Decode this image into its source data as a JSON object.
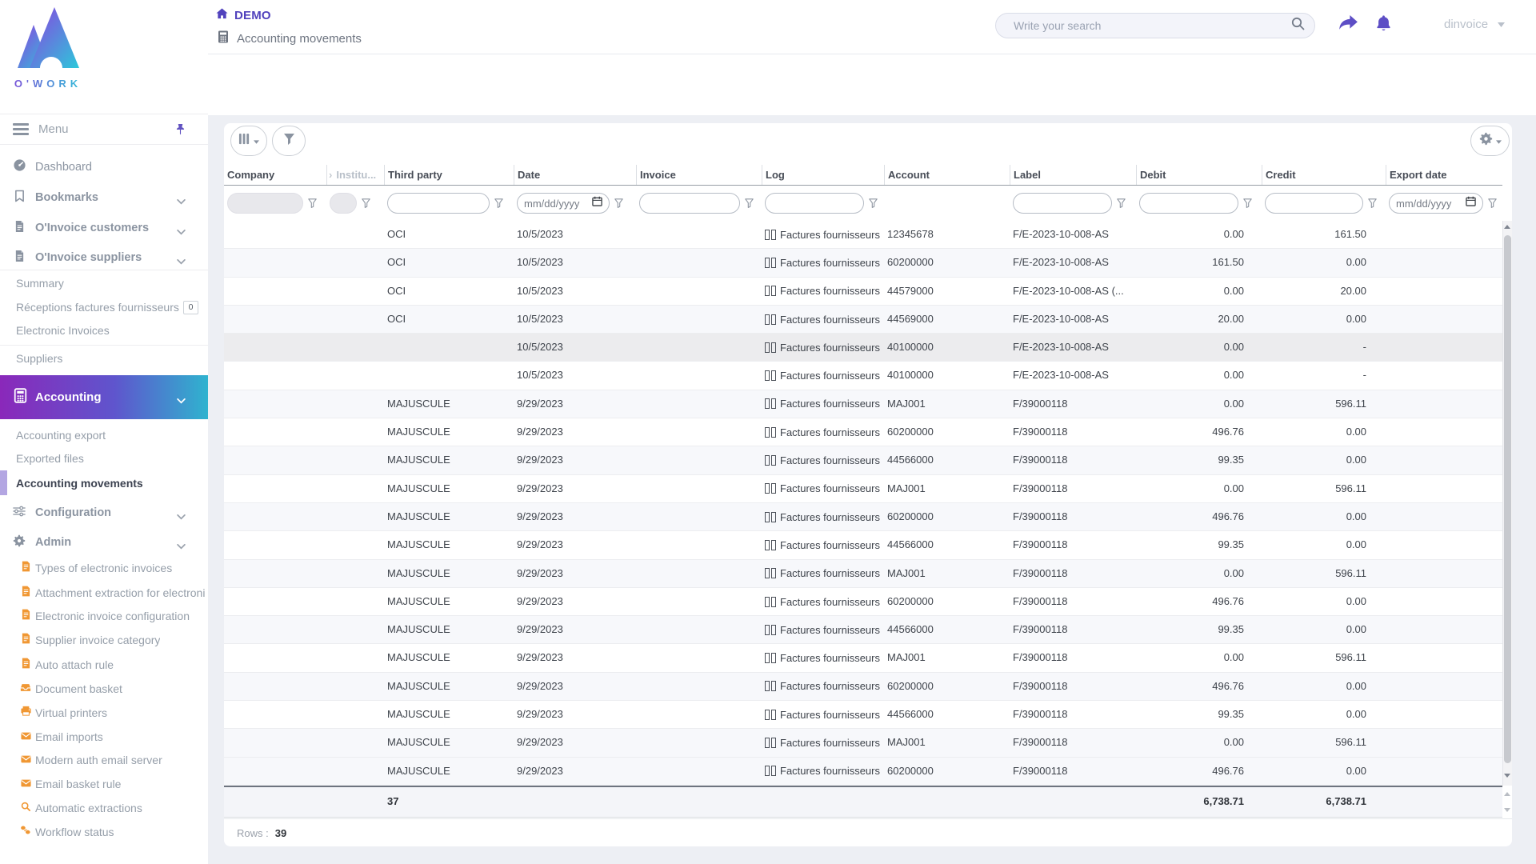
{
  "brand": {
    "logo_text": "O'WORK"
  },
  "topbar": {
    "breadcrumb": {
      "home": "DEMO",
      "page": "Accounting movements"
    },
    "search": {
      "placeholder": "Write your search"
    },
    "user": {
      "name": "dinvoice"
    }
  },
  "sidebar": {
    "menu_label": "Menu",
    "items": [
      {
        "label": "Dashboard",
        "icon": "gauge-icon"
      },
      {
        "label": "Bookmarks",
        "icon": "bookmark-icon"
      },
      {
        "label": "O'Invoice customers",
        "icon": "invoice-file-icon"
      },
      {
        "label": "O'Invoice suppliers",
        "icon": "invoice-file-icon"
      },
      {
        "label": "Summary"
      },
      {
        "label": "Réceptions factures fournisseurs",
        "badge": "0"
      },
      {
        "label": "Electronic Invoices"
      },
      {
        "label": "Suppliers"
      },
      {
        "label": "Accounting",
        "icon": "calculator-icon",
        "active": true
      },
      {
        "label": "Accounting export"
      },
      {
        "label": "Exported files"
      },
      {
        "label": "Accounting movements",
        "active": true
      },
      {
        "label": "Configuration",
        "icon": "sliders-icon"
      },
      {
        "label": "Admin",
        "icon": "gear-icon"
      },
      {
        "label": "Types of electronic invoices",
        "icon": "file-lines-icon"
      },
      {
        "label": "Attachment extraction for electroni",
        "icon": "file-lines-icon"
      },
      {
        "label": "Electronic invoice configuration",
        "icon": "file-lines-icon"
      },
      {
        "label": "Supplier invoice category",
        "icon": "file-lines-icon"
      },
      {
        "label": "Auto attach rule",
        "icon": "file-lines-icon"
      },
      {
        "label": "Document basket",
        "icon": "inbox-icon"
      },
      {
        "label": "Virtual printers",
        "icon": "printer-icon"
      },
      {
        "label": "Email imports",
        "icon": "envelope-icon"
      },
      {
        "label": "Modern auth email server",
        "icon": "envelope-icon"
      },
      {
        "label": "Email basket rule",
        "icon": "envelope-icon"
      },
      {
        "label": "Automatic extractions",
        "icon": "magnifier-icon"
      },
      {
        "label": "Workflow status",
        "icon": "footprints-icon"
      }
    ]
  },
  "table": {
    "columns": [
      "Company",
      "Institu...",
      "Third party",
      "Date",
      "Invoice",
      "Log",
      "Account",
      "Label",
      "Debit",
      "Credit",
      "Export date"
    ],
    "date_filter_placeholder": "mm/dd/yyyy",
    "rows": [
      {
        "company": "",
        "third_party": "OCI",
        "date": "10/5/2023",
        "invoice": "",
        "log": "Factures fournisseurs",
        "account": "12345678",
        "label": "F/E-2023-10-008-AS",
        "debit": "0.00",
        "credit": "161.50",
        "export_date": "",
        "shade": "white"
      },
      {
        "company": "",
        "third_party": "OCI",
        "date": "10/5/2023",
        "invoice": "",
        "log": "Factures fournisseurs",
        "account": "60200000",
        "label": "F/E-2023-10-008-AS",
        "debit": "161.50",
        "credit": "0.00",
        "export_date": "",
        "shade": "stripe"
      },
      {
        "company": "",
        "third_party": "OCI",
        "date": "10/5/2023",
        "invoice": "",
        "log": "Factures fournisseurs",
        "account": "44579000",
        "label": "F/E-2023-10-008-AS (...",
        "debit": "0.00",
        "credit": "20.00",
        "export_date": "",
        "shade": "white"
      },
      {
        "company": "",
        "third_party": "OCI",
        "date": "10/5/2023",
        "invoice": "",
        "log": "Factures fournisseurs",
        "account": "44569000",
        "label": "F/E-2023-10-008-AS",
        "debit": "20.00",
        "credit": "0.00",
        "export_date": "",
        "shade": "stripe"
      },
      {
        "company": "",
        "third_party": "",
        "date": "10/5/2023",
        "invoice": "",
        "log": "Factures fournisseurs",
        "account": "40100000",
        "label": "F/E-2023-10-008-AS",
        "debit": "0.00",
        "credit": "-",
        "export_date": "",
        "shade": "gray"
      },
      {
        "company": "",
        "third_party": "",
        "date": "10/5/2023",
        "invoice": "",
        "log": "Factures fournisseurs",
        "account": "40100000",
        "label": "F/E-2023-10-008-AS",
        "debit": "0.00",
        "credit": "-",
        "export_date": "",
        "shade": "white"
      },
      {
        "company": "",
        "third_party": "MAJUSCULE",
        "date": "9/29/2023",
        "invoice": "",
        "log": "Factures fournisseurs",
        "account": "MAJ001",
        "label": "F/39000118",
        "debit": "0.00",
        "credit": "596.11",
        "export_date": "",
        "shade": "stripe"
      },
      {
        "company": "",
        "third_party": "MAJUSCULE",
        "date": "9/29/2023",
        "invoice": "",
        "log": "Factures fournisseurs",
        "account": "60200000",
        "label": "F/39000118",
        "debit": "496.76",
        "credit": "0.00",
        "export_date": "",
        "shade": "white"
      },
      {
        "company": "",
        "third_party": "MAJUSCULE",
        "date": "9/29/2023",
        "invoice": "",
        "log": "Factures fournisseurs",
        "account": "44566000",
        "label": "F/39000118",
        "debit": "99.35",
        "credit": "0.00",
        "export_date": "",
        "shade": "stripe"
      },
      {
        "company": "",
        "third_party": "MAJUSCULE",
        "date": "9/29/2023",
        "invoice": "",
        "log": "Factures fournisseurs",
        "account": "MAJ001",
        "label": "F/39000118",
        "debit": "0.00",
        "credit": "596.11",
        "export_date": "",
        "shade": "white"
      },
      {
        "company": "",
        "third_party": "MAJUSCULE",
        "date": "9/29/2023",
        "invoice": "",
        "log": "Factures fournisseurs",
        "account": "60200000",
        "label": "F/39000118",
        "debit": "496.76",
        "credit": "0.00",
        "export_date": "",
        "shade": "stripe"
      },
      {
        "company": "",
        "third_party": "MAJUSCULE",
        "date": "9/29/2023",
        "invoice": "",
        "log": "Factures fournisseurs",
        "account": "44566000",
        "label": "F/39000118",
        "debit": "99.35",
        "credit": "0.00",
        "export_date": "",
        "shade": "white"
      },
      {
        "company": "",
        "third_party": "MAJUSCULE",
        "date": "9/29/2023",
        "invoice": "",
        "log": "Factures fournisseurs",
        "account": "MAJ001",
        "label": "F/39000118",
        "debit": "0.00",
        "credit": "596.11",
        "export_date": "",
        "shade": "stripe"
      },
      {
        "company": "",
        "third_party": "MAJUSCULE",
        "date": "9/29/2023",
        "invoice": "",
        "log": "Factures fournisseurs",
        "account": "60200000",
        "label": "F/39000118",
        "debit": "496.76",
        "credit": "0.00",
        "export_date": "",
        "shade": "white"
      },
      {
        "company": "",
        "third_party": "MAJUSCULE",
        "date": "9/29/2023",
        "invoice": "",
        "log": "Factures fournisseurs",
        "account": "44566000",
        "label": "F/39000118",
        "debit": "99.35",
        "credit": "0.00",
        "export_date": "",
        "shade": "stripe"
      },
      {
        "company": "",
        "third_party": "MAJUSCULE",
        "date": "9/29/2023",
        "invoice": "",
        "log": "Factures fournisseurs",
        "account": "MAJ001",
        "label": "F/39000118",
        "debit": "0.00",
        "credit": "596.11",
        "export_date": "",
        "shade": "white"
      },
      {
        "company": "",
        "third_party": "MAJUSCULE",
        "date": "9/29/2023",
        "invoice": "",
        "log": "Factures fournisseurs",
        "account": "60200000",
        "label": "F/39000118",
        "debit": "496.76",
        "credit": "0.00",
        "export_date": "",
        "shade": "stripe"
      },
      {
        "company": "",
        "third_party": "MAJUSCULE",
        "date": "9/29/2023",
        "invoice": "",
        "log": "Factures fournisseurs",
        "account": "44566000",
        "label": "F/39000118",
        "debit": "99.35",
        "credit": "0.00",
        "export_date": "",
        "shade": "white"
      },
      {
        "company": "",
        "third_party": "MAJUSCULE",
        "date": "9/29/2023",
        "invoice": "",
        "log": "Factures fournisseurs",
        "account": "MAJ001",
        "label": "F/39000118",
        "debit": "0.00",
        "credit": "596.11",
        "export_date": "",
        "shade": "stripe"
      },
      {
        "company": "",
        "third_party": "MAJUSCULE",
        "date": "9/29/2023",
        "invoice": "",
        "log": "Factures fournisseurs",
        "account": "60200000",
        "label": "F/39000118",
        "debit": "496.76",
        "credit": "0.00",
        "export_date": "",
        "shade": "stripe"
      }
    ],
    "summary": {
      "count": "37",
      "debit_total": "6,738.71",
      "credit_total": "6,738.71"
    },
    "footer": {
      "rows_label": "Rows :",
      "rows_count": "39"
    }
  },
  "colors": {
    "accent_purple": "#5d4ec5",
    "sidebar_gradient_start": "#8a28ba",
    "sidebar_gradient_end": "#2fb3cf",
    "admin_icon_orange": "#f09733"
  }
}
